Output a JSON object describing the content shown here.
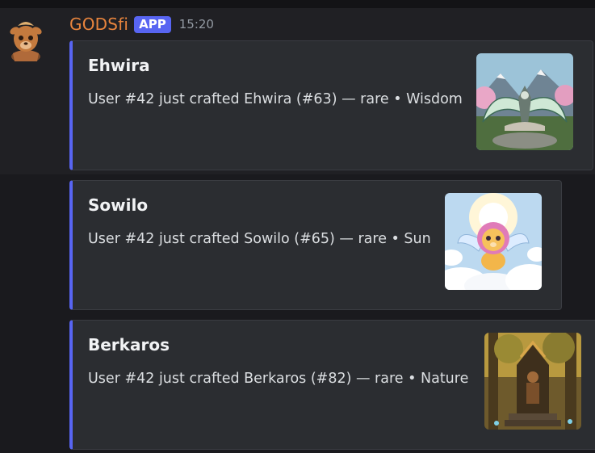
{
  "message": {
    "username": "GODSfi",
    "badge": "APP",
    "timestamp": "15:20",
    "avatar_icon": "deer-avatar-icon"
  },
  "embeds": [
    {
      "title": "Ehwira",
      "description": "User #42 just crafted Ehwira (#63) — rare • Wisdom",
      "thumbnail": "winged-crest-shrine-image",
      "accent": "#5865f2"
    },
    {
      "title": "Sowilo",
      "description": "User #42 just crafted Sowilo (#65) — rare • Sun",
      "thumbnail": "winged-lion-cub-image",
      "accent": "#5865f2"
    },
    {
      "title": "Berkaros",
      "description": "User #42 just crafted Berkaros (#82) — rare • Nature",
      "thumbnail": "forest-throne-image",
      "accent": "#5865f2"
    }
  ]
}
